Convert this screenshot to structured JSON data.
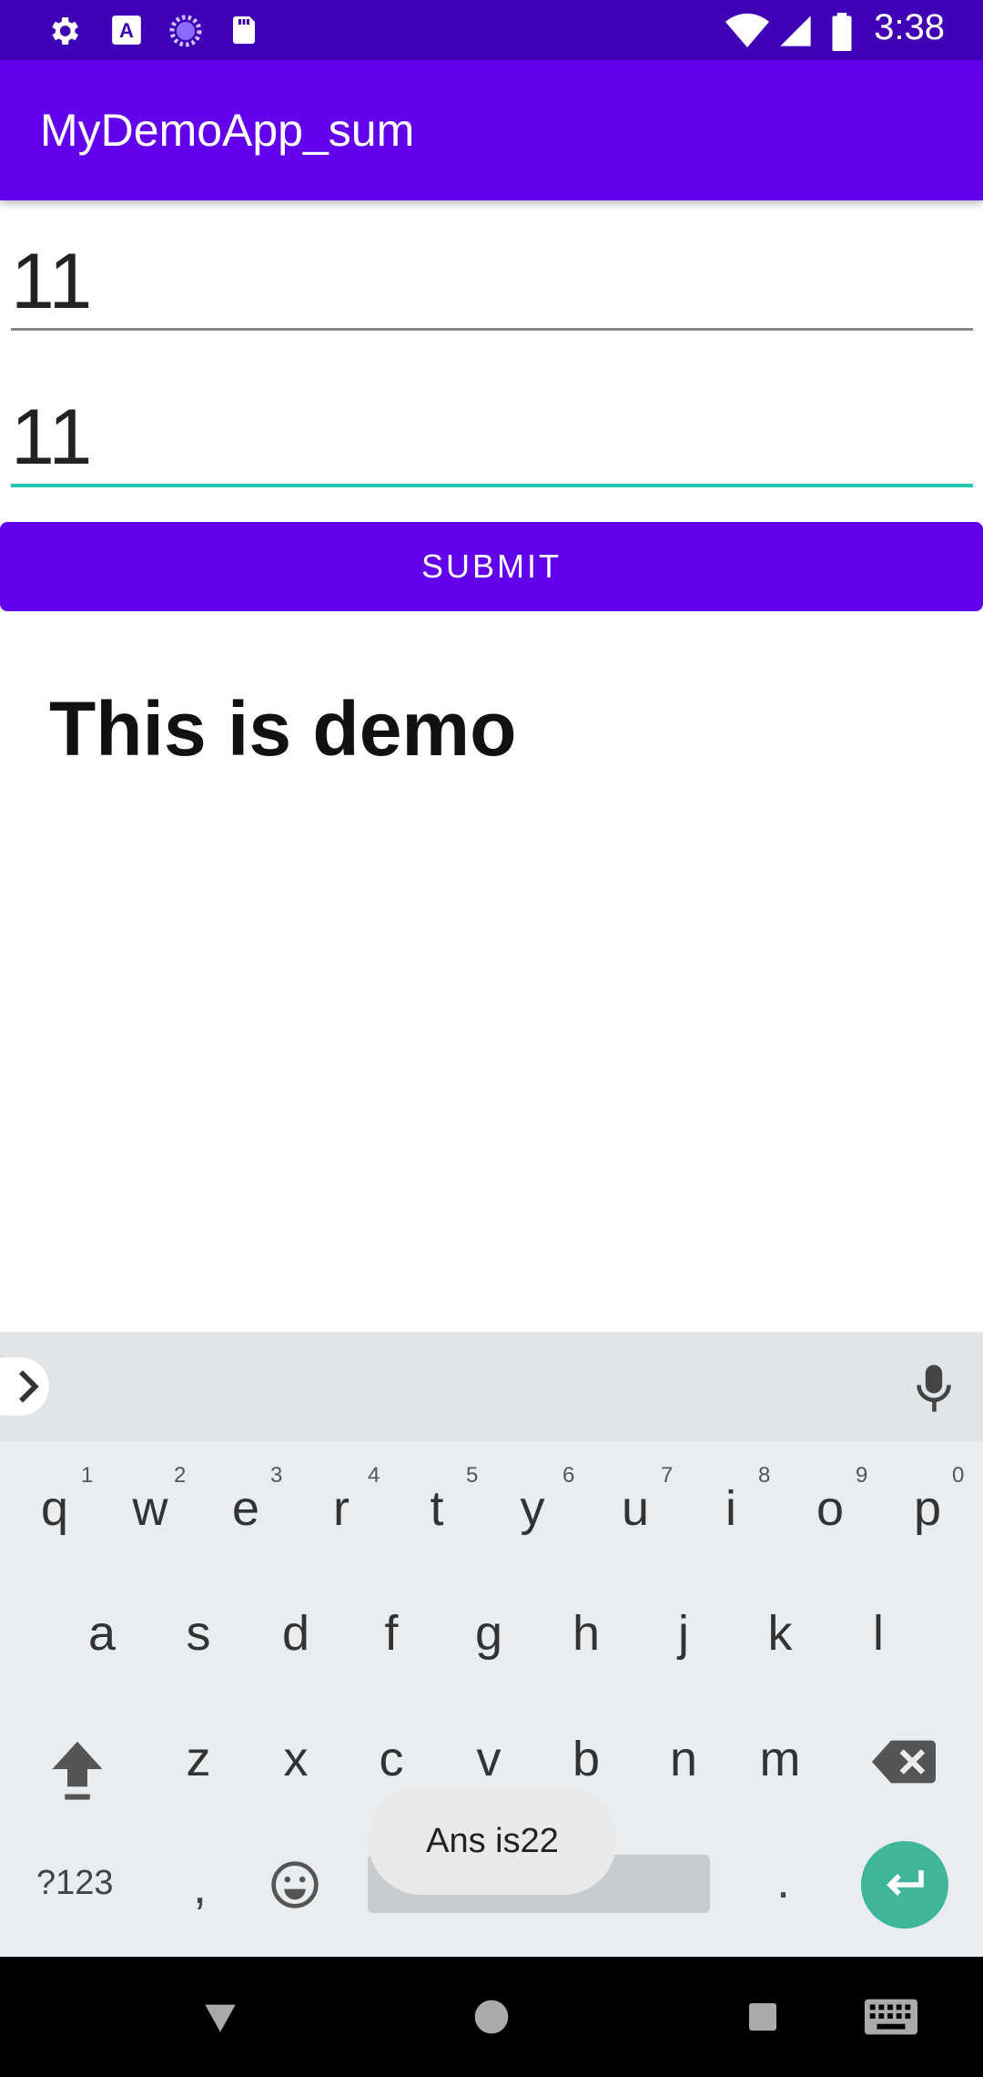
{
  "status_bar": {
    "time": "3:38",
    "icons": [
      "settings-icon",
      "text-a-icon",
      "spinner-icon",
      "sd-card-icon",
      "wifi-icon",
      "signal-icon",
      "battery-icon"
    ]
  },
  "app_bar": {
    "title": "MyDemoApp_sum"
  },
  "form": {
    "field1_value": "11",
    "field2_value": "11",
    "submit_label": "SUBMIT",
    "demo_text": "This is demo"
  },
  "keyboard": {
    "row1": [
      "q",
      "w",
      "e",
      "r",
      "t",
      "y",
      "u",
      "i",
      "o",
      "p"
    ],
    "row1_hints": [
      "1",
      "2",
      "3",
      "4",
      "5",
      "6",
      "7",
      "8",
      "9",
      "0"
    ],
    "row2": [
      "a",
      "s",
      "d",
      "f",
      "g",
      "h",
      "j",
      "k",
      "l"
    ],
    "row3": [
      "z",
      "x",
      "c",
      "v",
      "b",
      "n",
      "m"
    ],
    "symbols_label": "?123",
    "comma": ",",
    "period": "."
  },
  "toast": {
    "text": "Ans is22"
  },
  "colors": {
    "primary": "#6200ee",
    "status_bar": "#3f00b5",
    "accent": "#26c6b0"
  }
}
